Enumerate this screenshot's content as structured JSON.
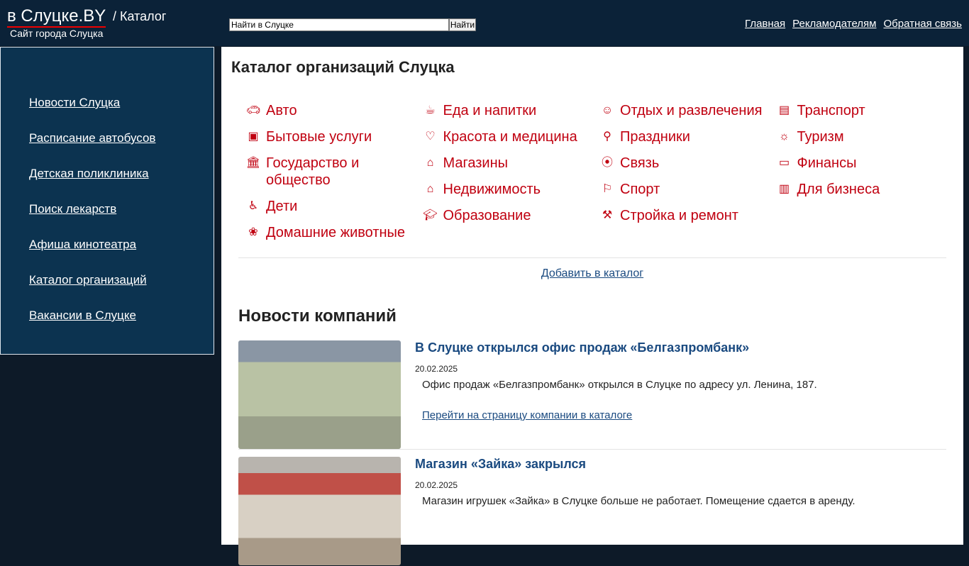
{
  "header": {
    "logo": "в Слуцке.BY",
    "crumb": "/ Каталог",
    "tagline": "Сайт города Слуцка",
    "search_value": "Найти в Слуцке",
    "search_button": "Найти",
    "nav": [
      "Главная",
      "Рекламодателям",
      "Обратная связь"
    ]
  },
  "sidebar": [
    "Новости Слуцка",
    "Расписание автобусов",
    "Детская поликлиника",
    "Поиск лекарств",
    "Афиша кинотеатра",
    "Каталог организаций",
    "Вакансии в Слуцке"
  ],
  "catalog": {
    "title": "Каталог организаций Слуцка",
    "accent": "#c00010",
    "columns": [
      [
        {
          "icon": "car",
          "label": "Авто"
        },
        {
          "icon": "washing-machine",
          "label": "Бытовые услуги"
        },
        {
          "icon": "government-building",
          "label": "Государство и общество"
        },
        {
          "icon": "stroller",
          "label": "Дети"
        },
        {
          "icon": "paw",
          "label": "Домашние животные"
        }
      ],
      [
        {
          "icon": "coffee-cup",
          "label": "Еда и напитки"
        },
        {
          "icon": "heart",
          "label": "Красота и медицина"
        },
        {
          "icon": "shop",
          "label": "Магазины"
        },
        {
          "icon": "house",
          "label": "Недвижимость"
        },
        {
          "icon": "graduation-cap",
          "label": "Образование"
        }
      ],
      [
        {
          "icon": "theater-masks",
          "label": "Отдых и развлечения"
        },
        {
          "icon": "balloons",
          "label": "Праздники"
        },
        {
          "icon": "antenna",
          "label": "Связь"
        },
        {
          "icon": "runner",
          "label": "Спорт"
        },
        {
          "icon": "paint-roller",
          "label": "Стройка и ремонт"
        }
      ],
      [
        {
          "icon": "bus",
          "label": "Транспорт"
        },
        {
          "icon": "sun",
          "label": "Туризм"
        },
        {
          "icon": "wallet",
          "label": "Финансы"
        },
        {
          "icon": "briefcase",
          "label": "Для бизнеса"
        }
      ]
    ],
    "add_link": "Добавить в каталог"
  },
  "news": {
    "title": "Новости компаний",
    "items": [
      {
        "title": "В Слуцке открылся офис продаж «Белгазпромбанк»",
        "date": "20.02.2025",
        "text": "Офис продаж «Белгазпромбанк» открылся в Слуцке по адресу ул. Ленина, 187.",
        "link": "Перейти на страницу компании в каталоге"
      },
      {
        "title": "Магазин «Зайка» закрылся",
        "date": "20.02.2025",
        "text": "Магазин игрушек «Зайка» в Слуцке больше не работает. Помещение сдается в аренду."
      }
    ]
  }
}
